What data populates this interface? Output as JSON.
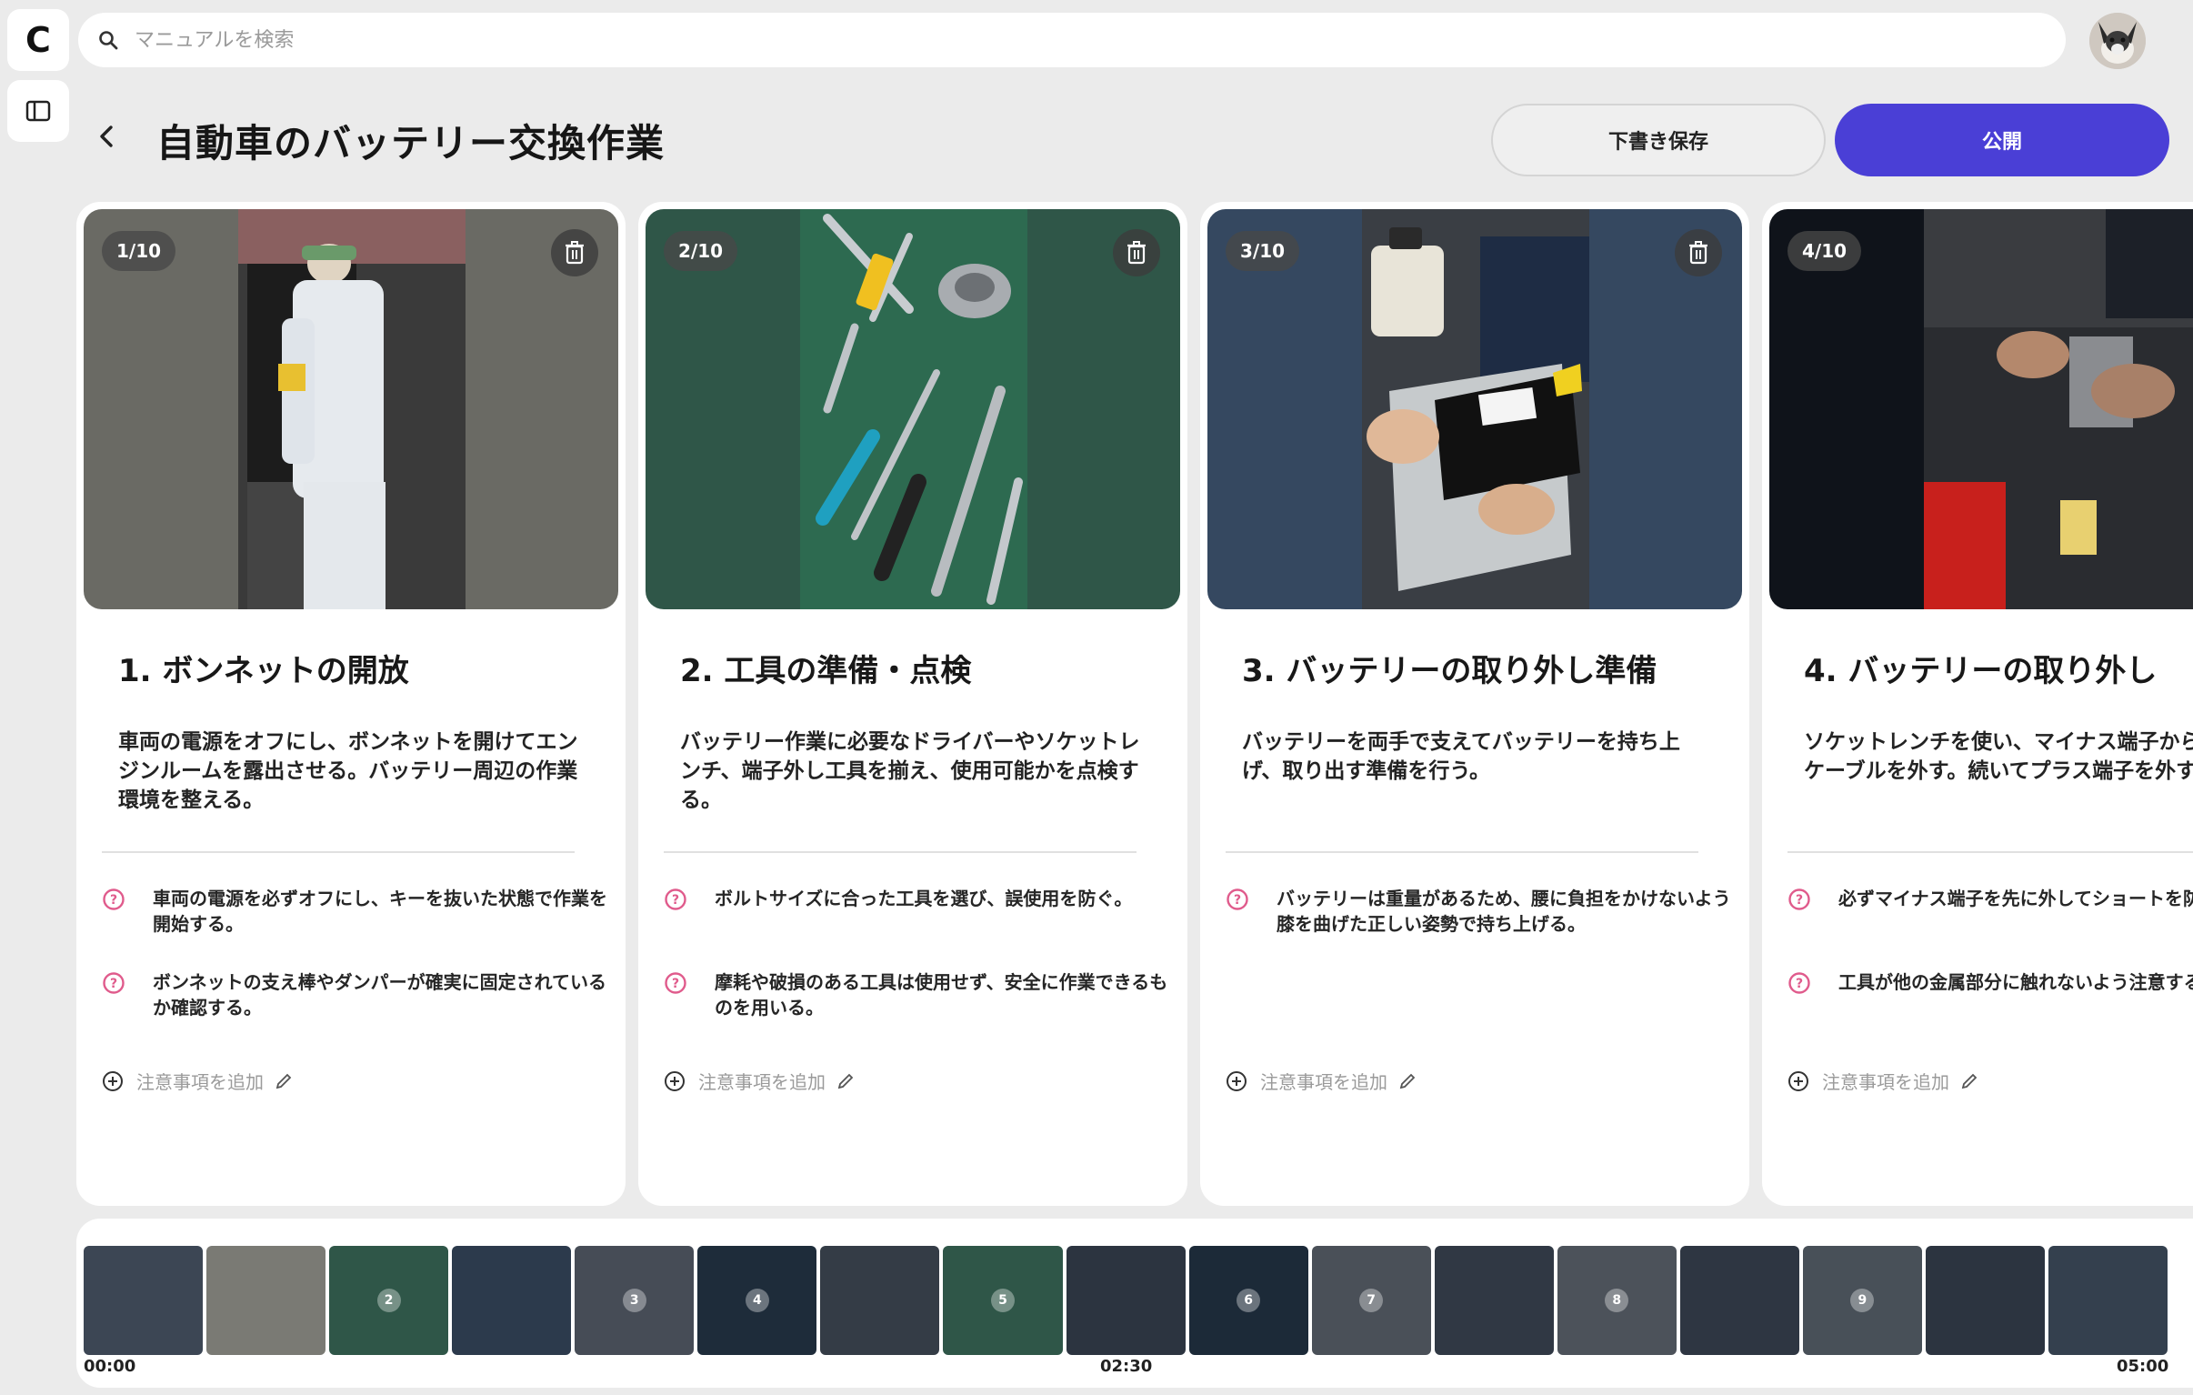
{
  "app": {
    "logo_letter": "C"
  },
  "search": {
    "placeholder": "マニュアルを検索"
  },
  "header": {
    "title": "自動車のバッテリー交換作業",
    "draft_label": "下書き保存",
    "publish_label": "公開"
  },
  "colors": {
    "accent": "#4a3fd6",
    "note_icon": "#e05b8c"
  },
  "add_note_label": "注意事項を追加",
  "steps": [
    {
      "badge": "1/10",
      "title": "1. ボンネットの開放",
      "description": "車両の電源をオフにし、ボンネットを開けてエンジンルームを露出させる。バッテリー周辺の作業環境を整える。",
      "notes": [
        "車両の電源を必ずオフにし、キーを抜いた状態で作業を開始する。",
        "ボンネットの支え棒やダンパーが確実に固定されているか確認する。"
      ],
      "image_bg": "#6a6a64"
    },
    {
      "badge": "2/10",
      "title": "2. 工具の準備・点検",
      "description": "バッテリー作業に必要なドライバーやソケットレンチ、端子外し工具を揃え、使用可能かを点検する。",
      "notes": [
        "ボルトサイズに合った工具を選び、誤使用を防ぐ。",
        "摩耗や破損のある工具は使用せず、安全に作業できるものを用いる。"
      ],
      "image_bg": "#2f5648"
    },
    {
      "badge": "3/10",
      "title": "3. バッテリーの取り外し準備",
      "description": "バッテリーを両手で支えてバッテリーを持ち上げ、取り出す準備を行う。",
      "notes": [
        "バッテリーは重量があるため、腰に負担をかけないよう膝を曲げた正しい姿勢で持ち上げる。"
      ],
      "image_bg": "#354860"
    },
    {
      "badge": "4/10",
      "title": "4. バッテリーの取り外し",
      "description": "ソケットレンチを使い、マイナス端子から緩めてケーブルを外す。続いてプラス端子を外す。",
      "notes": [
        "必ずマイナス端子を先に外してショートを防ぐ。",
        "工具が他の金属部分に触れないよう注意する。"
      ],
      "image_bg": "#0f131a"
    }
  ],
  "timeline": {
    "start": "00:00",
    "middle": "02:30",
    "end": "05:00",
    "frames": [
      {
        "c": "#3c4654",
        "n": ""
      },
      {
        "c": "#7a7a74",
        "n": ""
      },
      {
        "c": "#2f5648",
        "n": "2"
      },
      {
        "c": "#2c3a4c",
        "n": ""
      },
      {
        "c": "#464c56",
        "n": "3"
      },
      {
        "c": "#1e2c3a",
        "n": "4"
      },
      {
        "c": "#343c46",
        "n": ""
      },
      {
        "c": "#2f5648",
        "n": "5"
      },
      {
        "c": "#2c3440",
        "n": ""
      },
      {
        "c": "#1c2a38",
        "n": "6"
      },
      {
        "c": "#4a5058",
        "n": "7"
      },
      {
        "c": "#303844",
        "n": ""
      },
      {
        "c": "#4c525a",
        "n": "8"
      },
      {
        "c": "#2e3642",
        "n": ""
      },
      {
        "c": "#485058",
        "n": "9"
      },
      {
        "c": "#2c3440",
        "n": ""
      },
      {
        "c": "#34404e",
        "n": ""
      }
    ]
  }
}
